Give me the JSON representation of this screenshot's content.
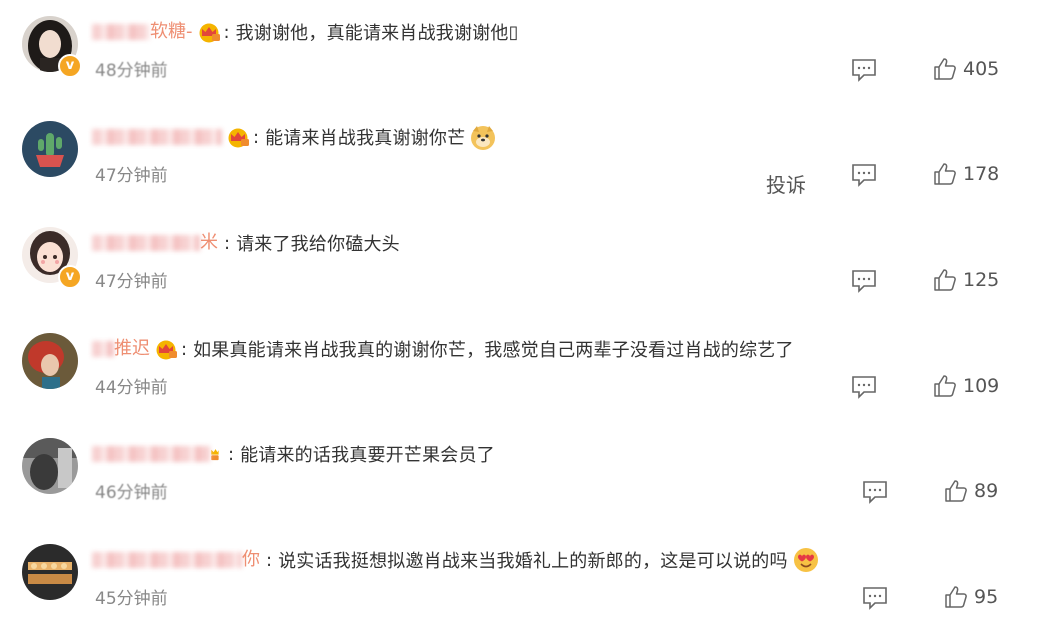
{
  "comments": [
    {
      "name_visible": "软糖-",
      "text": "我谢谢他，真能请来肖战我谢谢他",
      "trailing_glyph": "▯",
      "time": "48分钟前",
      "likes": "405",
      "verified": true,
      "avatar": "woman-dark-hair-avatar",
      "emoji": null
    },
    {
      "name_visible": "",
      "text": "能请来肖战我真谢谢你芒",
      "time": "47分钟前",
      "likes": "178",
      "verified": false,
      "avatar": "cactus-avatar",
      "emoji": "doge-emoji",
      "report_label": "投诉"
    },
    {
      "name_visible": "米",
      "text": "请来了我给你磕大头",
      "time": "47分钟前",
      "likes": "125",
      "verified": true,
      "avatar": "cartoon-girl-avatar",
      "emoji": null
    },
    {
      "name_visible": "推迟",
      "text": "如果真能请来肖战我真的谢谢你芒，我感觉自己两辈子没看过肖战的综艺了",
      "time": "44分钟前",
      "likes": "109",
      "verified": false,
      "avatar": "red-hair-avatar",
      "emoji": null
    },
    {
      "name_visible": "",
      "text": "能请来的话我真要开芒果会员了",
      "time": "46分钟前",
      "likes": "89",
      "verified": false,
      "avatar": "grayscale-photo-avatar",
      "emoji": null
    },
    {
      "name_visible": "你",
      "text": "说实话我挺想拟邀肖战来当我婚礼上的新郎的，这是可以说的吗",
      "time": "45分钟前",
      "likes": "95",
      "verified": false,
      "avatar": "food-tray-avatar",
      "emoji": "heart-eyes-emoji"
    }
  ],
  "colors": {
    "username": "#eb7350",
    "text": "#333333",
    "meta": "#888888",
    "verified_badge": "#f5a623",
    "crown_gold": "#f5b400",
    "crown_red": "#e2463a"
  }
}
